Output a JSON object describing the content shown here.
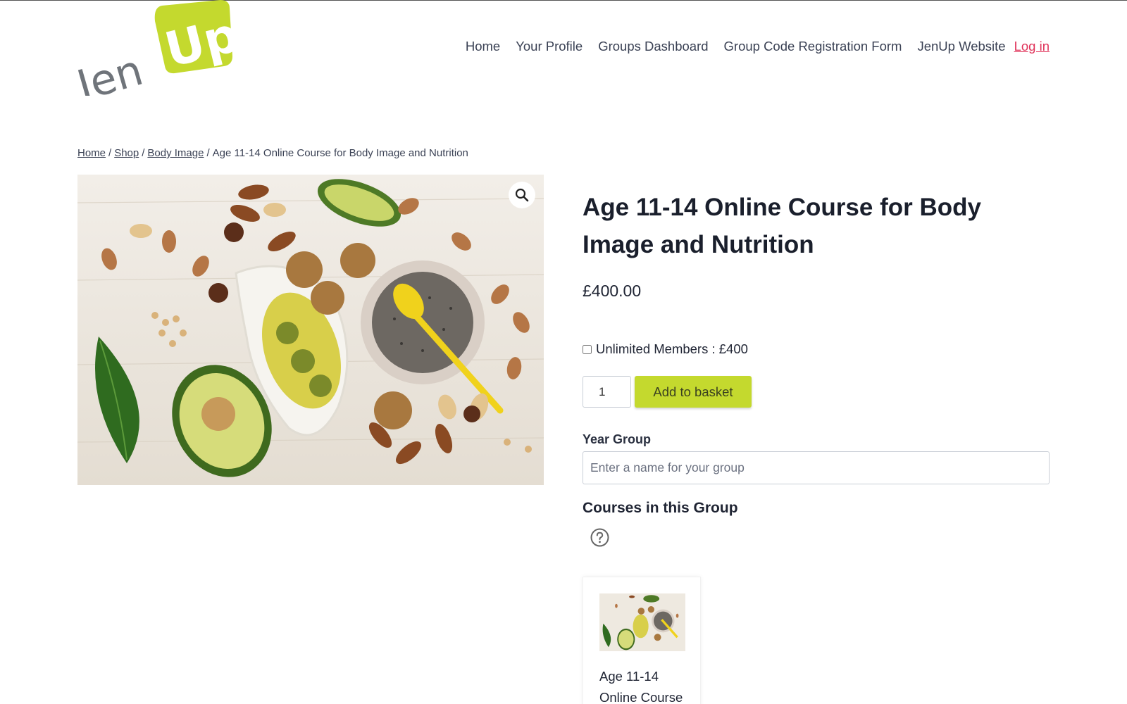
{
  "brand": {
    "logo_word": "Jen",
    "logo_badge": "Up",
    "colors": {
      "accent": "#c4d92e",
      "logo_grey": "#6f747a",
      "link_red": "#e0335a",
      "text": "#1f2433"
    }
  },
  "nav": {
    "items": [
      {
        "label": "Home"
      },
      {
        "label": "Your Profile"
      },
      {
        "label": "Groups Dashboard"
      },
      {
        "label": "Group Code Registration Form"
      },
      {
        "label": "JenUp Website"
      }
    ],
    "login": "Log in"
  },
  "breadcrumb": {
    "links": [
      "Home",
      "Shop",
      "Body Image"
    ],
    "separator": "/",
    "current": "Age 11-14 Online Course for Body Image and Nutrition"
  },
  "product": {
    "title": "Age 11-14 Online Course for Body Image and Nutrition",
    "price": "£400.00",
    "option_label": "Unlimited Members : £400",
    "option_checked": false,
    "quantity": "1",
    "add_to_basket": "Add to basket",
    "zoom_icon": "magnifier-icon",
    "image_subject": "healthy-fats-food-photo"
  },
  "group_form": {
    "label": "Year Group",
    "placeholder": "Enter a name for your group",
    "courses_heading": "Courses in this Group",
    "help_icon": "question-circle-icon"
  },
  "course_cards": [
    {
      "name": "Age 11-14 Online Course"
    }
  ]
}
